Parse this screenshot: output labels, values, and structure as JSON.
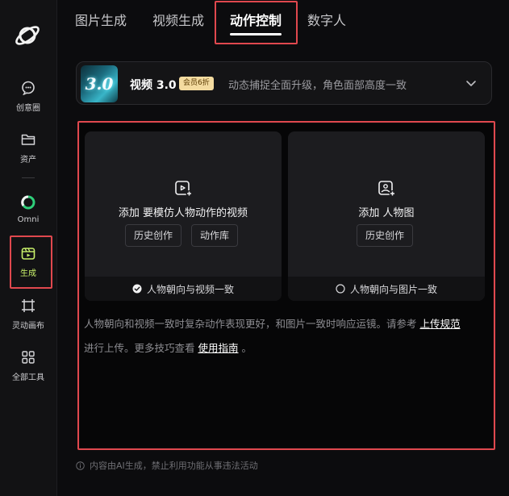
{
  "sidebar": {
    "items": [
      {
        "label": "创意圈",
        "icon": "chat-bubble-icon"
      },
      {
        "label": "资产",
        "icon": "folder-icon"
      },
      {
        "label": "Omni",
        "icon": "omni-ring-icon"
      },
      {
        "label": "生成",
        "icon": "generate-icon"
      },
      {
        "label": "灵动画布",
        "icon": "canvas-frame-icon"
      },
      {
        "label": "全部工具",
        "icon": "grid-apps-icon"
      }
    ],
    "active": "生成",
    "accent_color": "#c9f26b"
  },
  "tabs": [
    {
      "label": "图片生成"
    },
    {
      "label": "视频生成"
    },
    {
      "label": "动作控制"
    },
    {
      "label": "数字人"
    }
  ],
  "active_tab": "动作控制",
  "highlight_color": "#e0484e",
  "model": {
    "thumb_text": "3.0",
    "name": "视频 3.0",
    "badge": "会员6折",
    "description": "动态捕捉全面升级，角色面部高度一致"
  },
  "cards": {
    "video": {
      "title": "添加 要模仿人物动作的视频",
      "buttons": [
        "历史创作",
        "动作库"
      ],
      "footer": "人物朝向与视频一致",
      "footer_checked": true
    },
    "image": {
      "title": "添加 人物图",
      "buttons": [
        "历史创作"
      ],
      "footer": "人物朝向与图片一致",
      "footer_checked": false
    }
  },
  "info": {
    "text_1": "人物朝向和视频一致时复杂动作表现更好，和图片一致时响应运镜。请参考",
    "link_1": "上传规范",
    "text_2": "进行上传。更多技巧查看",
    "link_2": "使用指南",
    "text_3": "。"
  },
  "disclaimer": "内容由AI生成，禁止利用功能从事违法活动"
}
